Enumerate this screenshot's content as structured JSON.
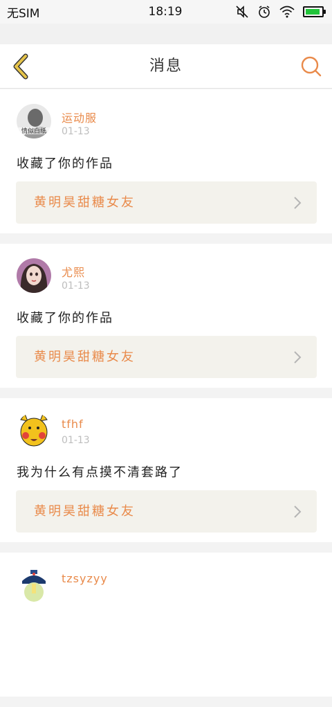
{
  "status_bar": {
    "carrier": "无SIM",
    "time": "18:19",
    "icons": [
      "mute-icon",
      "alarm-icon",
      "wifi-icon",
      "battery-icon"
    ],
    "battery_level": 0.9,
    "battery_color": "#22c43a"
  },
  "header": {
    "title": "消息",
    "back_icon": "chevron-left-icon",
    "search_icon": "search-icon",
    "accent_color": "#e98a4a",
    "back_color": "#e6c44a"
  },
  "messages": [
    {
      "username": "运动服",
      "date": "01-13",
      "text": "收藏了你的作品",
      "work_title": "黄明昊甜糖女友",
      "avatar_text": "情似白纸"
    },
    {
      "username": "尤熙",
      "date": "01-13",
      "text": "收藏了你的作品",
      "work_title": "黄明昊甜糖女友"
    },
    {
      "username": "tfhf",
      "date": "01-13",
      "text": "我为什么有点摸不清套路了",
      "work_title": "黄明昊甜糖女友"
    },
    {
      "username": "tzsyzyy",
      "date": "",
      "text": "",
      "work_title": ""
    }
  ]
}
